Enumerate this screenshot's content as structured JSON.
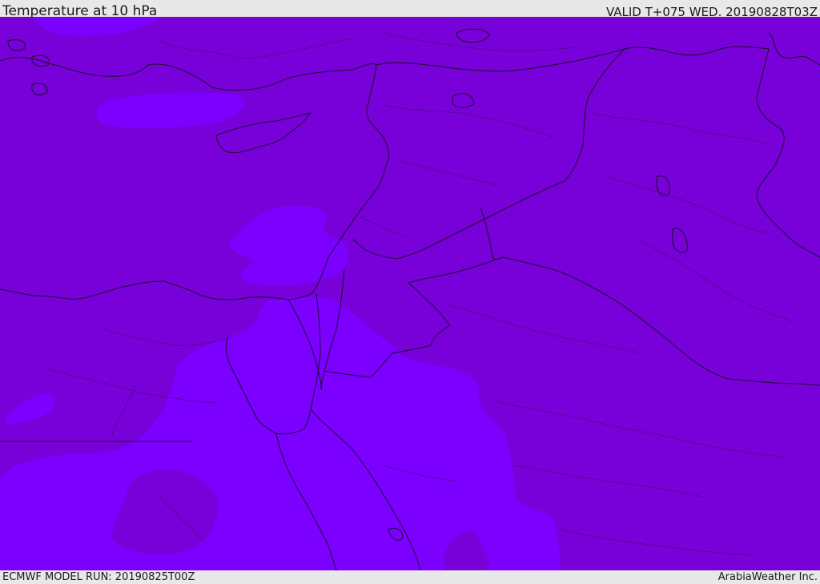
{
  "header": {
    "title": "Temperature at 10 hPa",
    "valid_time": "VALID T+075 WED. 20190828T03Z"
  },
  "footer": {
    "model_run": "ECMWF MODEL RUN: 20190825T00Z",
    "credit": "ArabiaWeather Inc."
  },
  "map": {
    "colors": {
      "base_fill": "#7800d8",
      "warm_region_fill": "#7c00ff",
      "coastline": "#1a0a2a"
    },
    "icons": [
      "coastline-layer",
      "country-border-layer",
      "admin-border-layer"
    ]
  }
}
